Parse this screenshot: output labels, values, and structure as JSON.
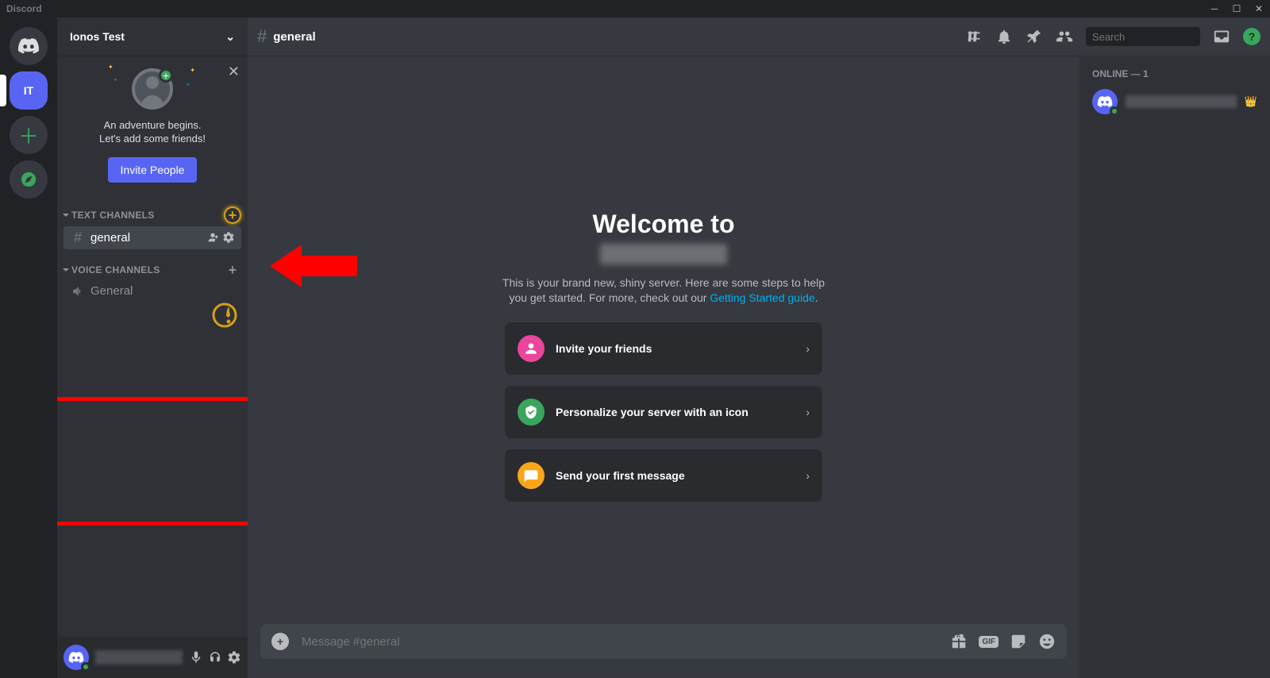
{
  "app": {
    "name": "Discord"
  },
  "guilds": {
    "selected_label": "IT"
  },
  "server": {
    "name": "Ionos Test",
    "invite_title": "An adventure begins.",
    "invite_sub": "Let's add some friends!",
    "invite_button": "Invite People",
    "text_channels_header": "TEXT CHANNELS",
    "voice_channels_header": "VOICE CHANNELS",
    "text_channel": "general",
    "voice_channel": "General"
  },
  "header": {
    "channel": "general",
    "search_placeholder": "Search"
  },
  "welcome": {
    "title": "Welcome to",
    "desc1": "This is your brand new, shiny server. Here are some steps to help",
    "desc2": "you get started. For more, check out our ",
    "link": "Getting Started guide",
    "card1": "Invite your friends",
    "card2": "Personalize your server with an icon",
    "card3": "Send your first message"
  },
  "input": {
    "placeholder": "Message #general"
  },
  "members": {
    "header": "ONLINE — 1"
  }
}
